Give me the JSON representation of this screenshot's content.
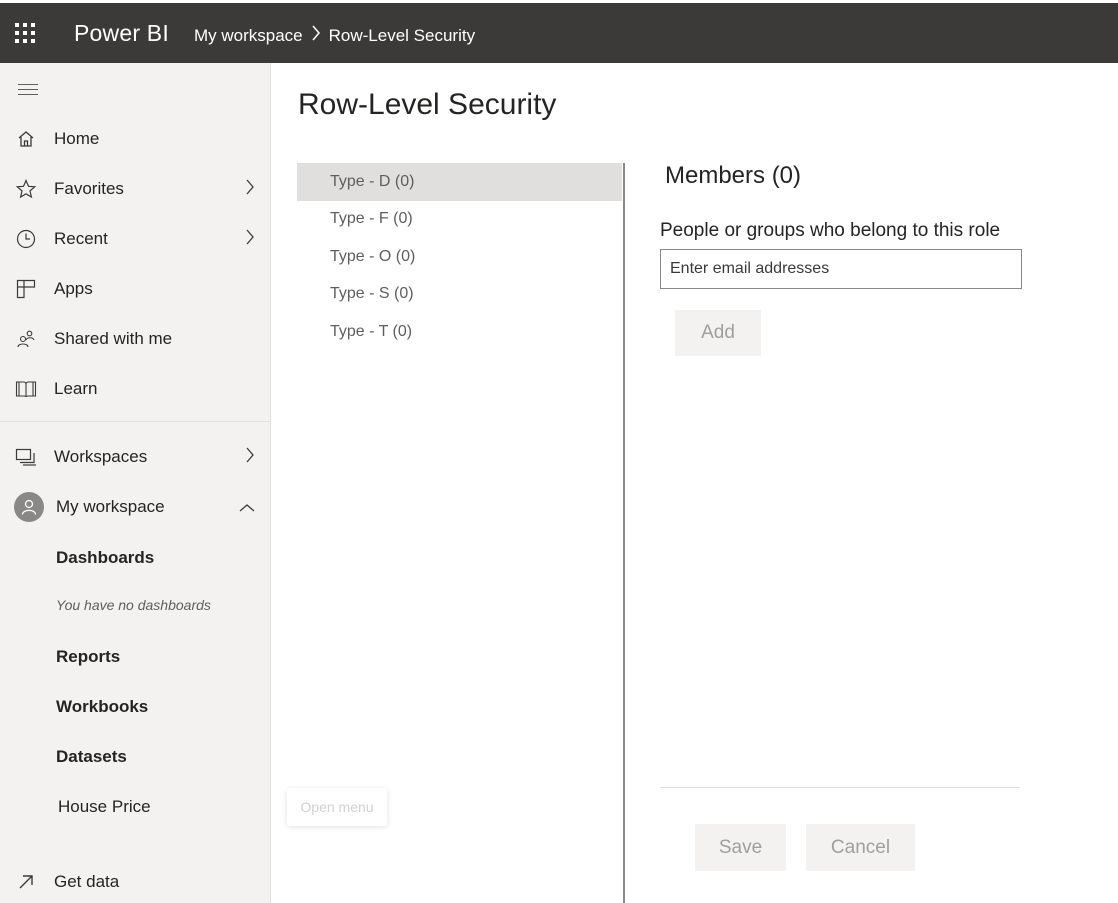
{
  "topbar": {
    "app_icon": "waffle-icon",
    "brand": "Power BI",
    "breadcrumb": [
      "My workspace",
      "Row-Level Security"
    ],
    "separator_icon": "chevron-right-icon"
  },
  "sidebar": {
    "menu_icon": "hamburger-icon",
    "items": [
      {
        "label": "Home",
        "icon": "home-icon"
      },
      {
        "label": "Favorites",
        "icon": "star-icon",
        "chevron": "›"
      },
      {
        "label": "Recent",
        "icon": "clock-icon",
        "chevron": "›"
      },
      {
        "label": "Apps",
        "icon": "apps-icon"
      },
      {
        "label": "Shared with me",
        "icon": "shared-icon"
      },
      {
        "label": "Learn",
        "icon": "book-icon"
      },
      {
        "label": "Workspaces",
        "icon": "workspaces-icon",
        "chevron": "›"
      },
      {
        "label": "My workspace",
        "icon": "avatar-icon",
        "chevron": "^"
      }
    ],
    "workspace_sections": {
      "dashboards": "Dashboards",
      "dashboards_empty": "You have no dashboards",
      "reports": "Reports",
      "workbooks": "Workbooks",
      "datasets": "Datasets",
      "dataset_item": "House Price"
    },
    "get_data": {
      "label": "Get data",
      "icon": "arrow-up-right-icon"
    },
    "tooltip": "Open menu"
  },
  "main": {
    "title": "Row-Level Security",
    "roles": [
      "Type - D (0)",
      "Type - F (0)",
      "Type - O (0)",
      "Type - S (0)",
      "Type - T (0)"
    ],
    "selected_role_index": 0,
    "members_title": "Members (0)",
    "members_desc": "People or groups who belong to this role",
    "email_placeholder": "Enter email addresses",
    "add_label": "Add",
    "save_label": "Save",
    "cancel_label": "Cancel"
  },
  "colors": {
    "topbar": "#3b3a39",
    "sidebar": "#f3f2f1",
    "selected_row": "#e1dfdd",
    "button_bg": "#f3f2f1",
    "button_text_disabled": "#a19f9d"
  }
}
